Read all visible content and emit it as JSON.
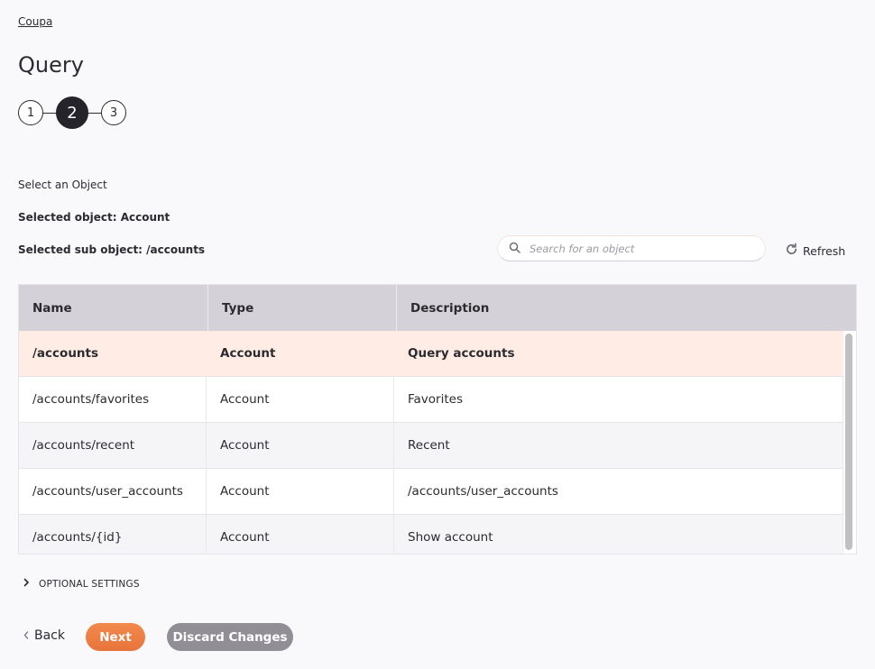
{
  "breadcrumb": {
    "label": "Coupa"
  },
  "page": {
    "title": "Query"
  },
  "stepper": {
    "steps": [
      "1",
      "2",
      "3"
    ],
    "active_step": 2
  },
  "object_selection": {
    "label": "Select an Object",
    "selected_object": "Selected object: Account",
    "selected_sub_object": "Selected sub object: /accounts"
  },
  "search": {
    "placeholder": "Search for an object",
    "value": "",
    "icon": "search-icon"
  },
  "refresh": {
    "label": "Refresh",
    "icon": "refresh-icon"
  },
  "table": {
    "columns": [
      "Name",
      "Type",
      "Description"
    ],
    "rows": [
      {
        "name": "/accounts",
        "type": "Account",
        "description": "Query accounts",
        "selected": true
      },
      {
        "name": "/accounts/favorites",
        "type": "Account",
        "description": "Favorites",
        "selected": false
      },
      {
        "name": "/accounts/recent",
        "type": "Account",
        "description": "Recent",
        "selected": false
      },
      {
        "name": "/accounts/user_accounts",
        "type": "Account",
        "description": "/accounts/user_accounts",
        "selected": false
      },
      {
        "name": "/accounts/{id}",
        "type": "Account",
        "description": "Show account",
        "selected": false
      }
    ]
  },
  "optional_settings": {
    "label": "OPTIONAL SETTINGS",
    "expanded": false
  },
  "footer": {
    "back_label": "Back",
    "next_label": "Next",
    "discard_label": "Discard Changes"
  },
  "colors": {
    "accent": "#e8743b",
    "selected_row": "#ffede5",
    "header_bg": "#d5d1d8",
    "discard_button": "#918e96",
    "active_step": "#25242b"
  }
}
